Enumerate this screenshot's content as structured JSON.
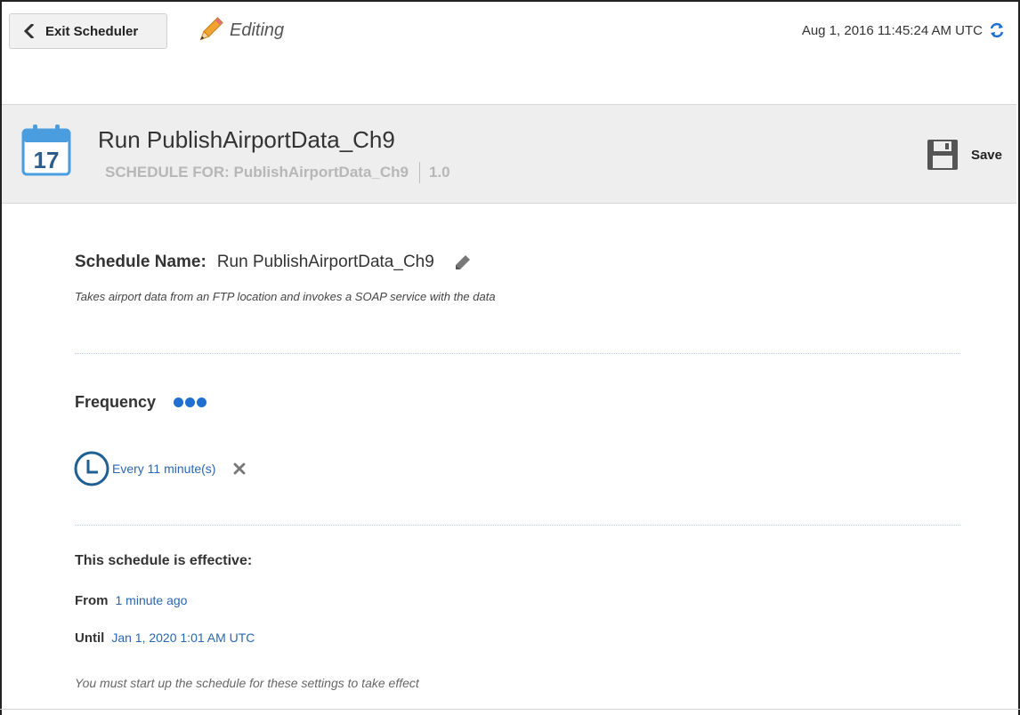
{
  "topbar": {
    "exit_label": "Exit Scheduler",
    "editing_label": "Editing",
    "timestamp": "Aug 1, 2016 11:45:24 AM UTC"
  },
  "header": {
    "calendar_day": "17",
    "title": "Run PublishAirportData_Ch9",
    "schedule_for": "SCHEDULE FOR: PublishAirportData_Ch9",
    "version": "1.0",
    "save_label": "Save"
  },
  "schedule": {
    "name_label": "Schedule Name:",
    "name_value": "Run PublishAirportData_Ch9",
    "description": "Takes airport data from an FTP location and invokes a SOAP service with the data"
  },
  "frequency": {
    "label": "Frequency",
    "item": "Every 11 minute(s)"
  },
  "effective": {
    "title": "This schedule is effective:",
    "from_label": "From",
    "from_value": "1 minute ago",
    "until_label": "Until",
    "until_value": "Jan 1, 2020 1:01 AM UTC",
    "note": "You must start up the schedule for these settings to take effect"
  },
  "colors": {
    "accent_blue": "#1f6fd1",
    "link_blue": "#2a66b3",
    "pencil_orange": "#f0a330",
    "header_bg": "#eeeeee"
  },
  "icons": [
    "chevron-left-icon",
    "pencil-icon",
    "refresh-icon",
    "calendar-icon",
    "save-disk-icon",
    "edit-pencil-icon",
    "more-dots-icon",
    "clock-icon",
    "remove-x-icon"
  ]
}
